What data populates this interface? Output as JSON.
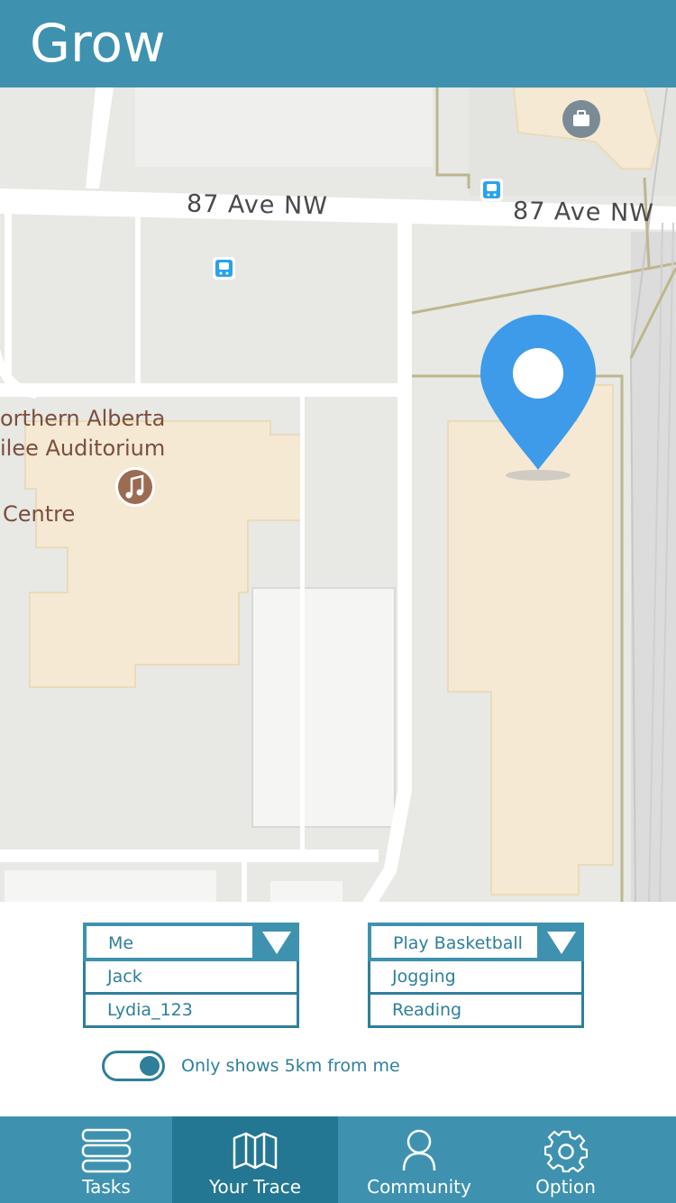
{
  "header": {
    "title": "Grow"
  },
  "map": {
    "streets": [
      "87 Ave NW",
      "87 Ave NW"
    ],
    "places": [
      "orthern Alberta",
      "ilee Auditorium",
      "Centre"
    ],
    "pin_color": "#3d9be9",
    "icons": [
      "bus-stop-icon",
      "bus-stop-icon",
      "briefcase-icon",
      "music-venue-icon"
    ]
  },
  "filters": {
    "people": {
      "selected": "Me",
      "options": [
        "Jack",
        "Lydia_123"
      ]
    },
    "activities": {
      "selected": "Play Basketball",
      "options": [
        "Jogging",
        "Reading"
      ]
    }
  },
  "toggle": {
    "label": "Only shows 5km from me",
    "on": true
  },
  "tabs": [
    {
      "label": "Tasks",
      "icon": "list-icon"
    },
    {
      "label": "Your Trace",
      "icon": "map-icon",
      "active": true
    },
    {
      "label": "Community",
      "icon": "person-icon"
    },
    {
      "label": "Option",
      "icon": "gear-icon"
    }
  ],
  "colors": {
    "primary": "#3e92af",
    "primary_dark": "#237792",
    "accent": "#2f7f9b"
  }
}
